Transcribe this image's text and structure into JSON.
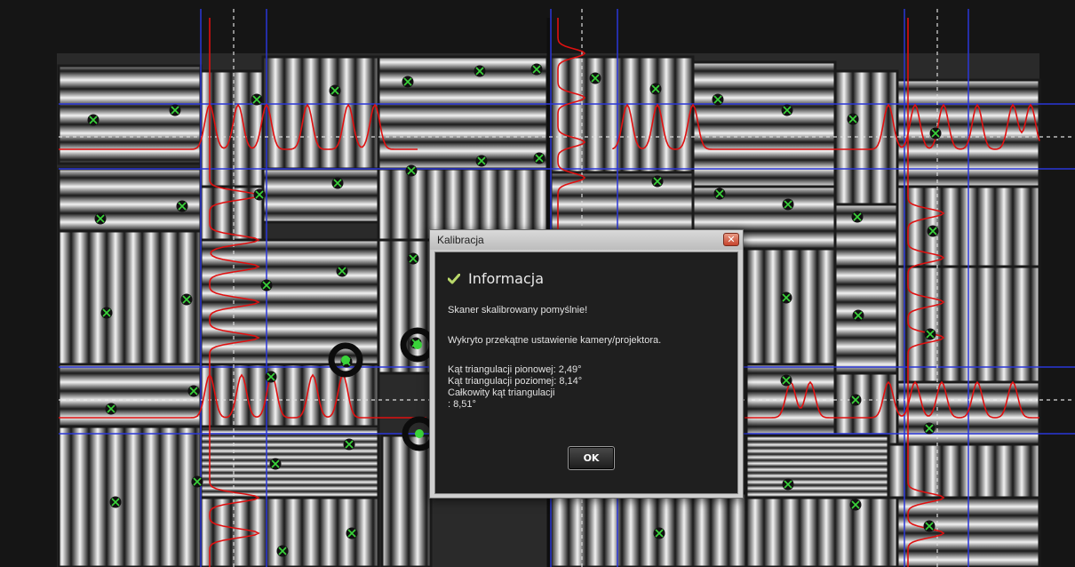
{
  "dialog": {
    "title": "Kalibracja",
    "close_icon": "close-icon",
    "heading_icon": "check-icon",
    "heading": "Informacja",
    "messages": [
      "Skaner skalibrowany pomyślnie!",
      "Wykryto przekątne ustawienie kamery/projektora.",
      "Kąt triangulacji pionowej: 2,49°",
      "Kąt triangulacji poziomej: 8,14°",
      "Całkowity kąt triangulacji",
      ": 8,51°"
    ],
    "ok_label": "OK"
  },
  "colors": {
    "profile_line": "#e01010",
    "grid_line": "#2a36d8",
    "dashed_line": "#dcdcdc",
    "marker_fill": "#111111",
    "marker_cross": "#3ad43a"
  }
}
